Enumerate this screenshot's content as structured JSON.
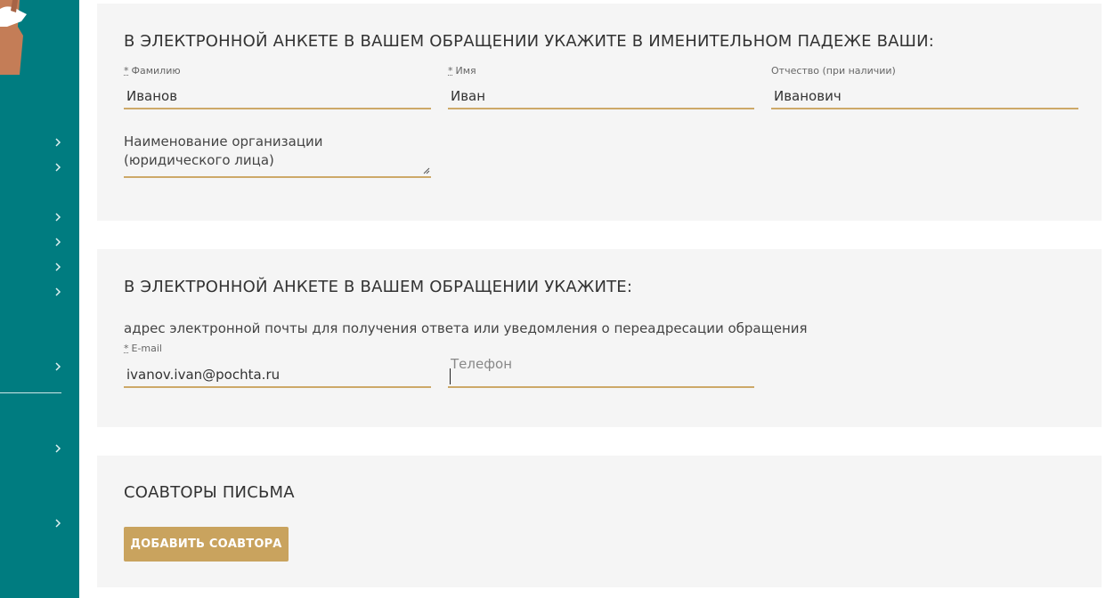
{
  "section_name": {
    "heading": "В ЭЛЕКТРОННОЙ АНКЕТЕ В ВАШЕМ ОБРАЩЕНИИ УКАЖИТЕ В ИМЕНИТЕЛЬНОМ ПАДЕЖЕ ВАШИ:",
    "last_name": {
      "required_mark": "*",
      "label": "Фамилию",
      "value": "Иванов"
    },
    "first_name": {
      "required_mark": "*",
      "label": "Имя",
      "value": "Иван"
    },
    "middle_name": {
      "label": "Отчество (при наличии)",
      "value": "Иванович"
    },
    "organization": {
      "placeholder_line1": "Наименование организации",
      "placeholder_line2": "(юридического лица)"
    }
  },
  "section_contact": {
    "heading": "В ЭЛЕКТРОННОЙ АНКЕТЕ В ВАШЕМ ОБРАЩЕНИИ УКАЖИТЕ:",
    "hint": "адрес электронной почты для получения ответа или уведомления о переадресации обращения",
    "email": {
      "required_mark": "*",
      "label": "E-mail",
      "value": "ivanov.ivan@pochta.ru"
    },
    "phone": {
      "placeholder": "Телефон"
    }
  },
  "section_coauthors": {
    "heading": "СОАВТОРЫ ПИСЬМА",
    "add_button_label": "ДОБАВИТЬ СОАВТОРА"
  },
  "colors": {
    "sidebar": "#007c80",
    "panel_bg": "#f5f5f5",
    "field_underline": "#cda968",
    "button_bg": "#c9a35e"
  },
  "sidebar_icons": [
    "chevron-right-icon"
  ]
}
